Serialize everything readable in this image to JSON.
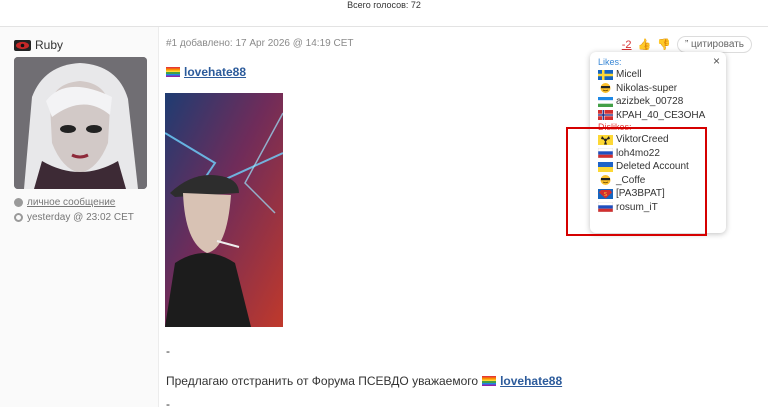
{
  "header": {
    "votes_total": "Всего голосов: 72"
  },
  "post": {
    "author": {
      "name": "Ruby",
      "flag_icon": "red-eye-icon"
    },
    "author_links": {
      "private_message": "личное сообщение",
      "last_seen": "yesterday @ 23:02 CET"
    },
    "header_text": "#1 добавлено: 17 Apr 2026 @ 14:19 CET",
    "score": "-2",
    "quote_label": "” цитировать",
    "mention_user": "lovehate88",
    "dash": "-",
    "body_text": "Предлагаю отстранить от Форума ПСЕВДО уважаемого",
    "body_mention": "lovehate88"
  },
  "votes_popup": {
    "close_label": "×",
    "likes_label": "Likes:",
    "likes": [
      {
        "name": "Micell",
        "flag": "sweden-flag"
      },
      {
        "name": "Nikolas-super",
        "flag": "smiley-sunglasses"
      },
      {
        "name": "azizbek_00728",
        "flag": "uzbekistan-flag"
      },
      {
        "name": "КРАН_40_СЕЗОНА",
        "flag": "norway-flag"
      }
    ],
    "dislikes_label": "Dislikes:",
    "dislikes": [
      {
        "name": "ViktorCreed",
        "flag": "radiation-icon"
      },
      {
        "name": "loh4mo22",
        "flag": "russia-flag"
      },
      {
        "name": "Deleted Account",
        "flag": "ukraine-flag"
      },
      {
        "name": "_Coffe",
        "flag": "smiley-sunglasses"
      },
      {
        "name": "[РАЗВРАТ]",
        "flag": "superman-icon"
      },
      {
        "name": "rosum_iT",
        "flag": "russia-flag"
      }
    ]
  },
  "colors": {
    "accent_link": "#2c5b9b",
    "score_negative": "#d63031",
    "highlight_box": "#d50000",
    "likes_title": "#3a88d6",
    "dislikes_title": "#e53935"
  }
}
